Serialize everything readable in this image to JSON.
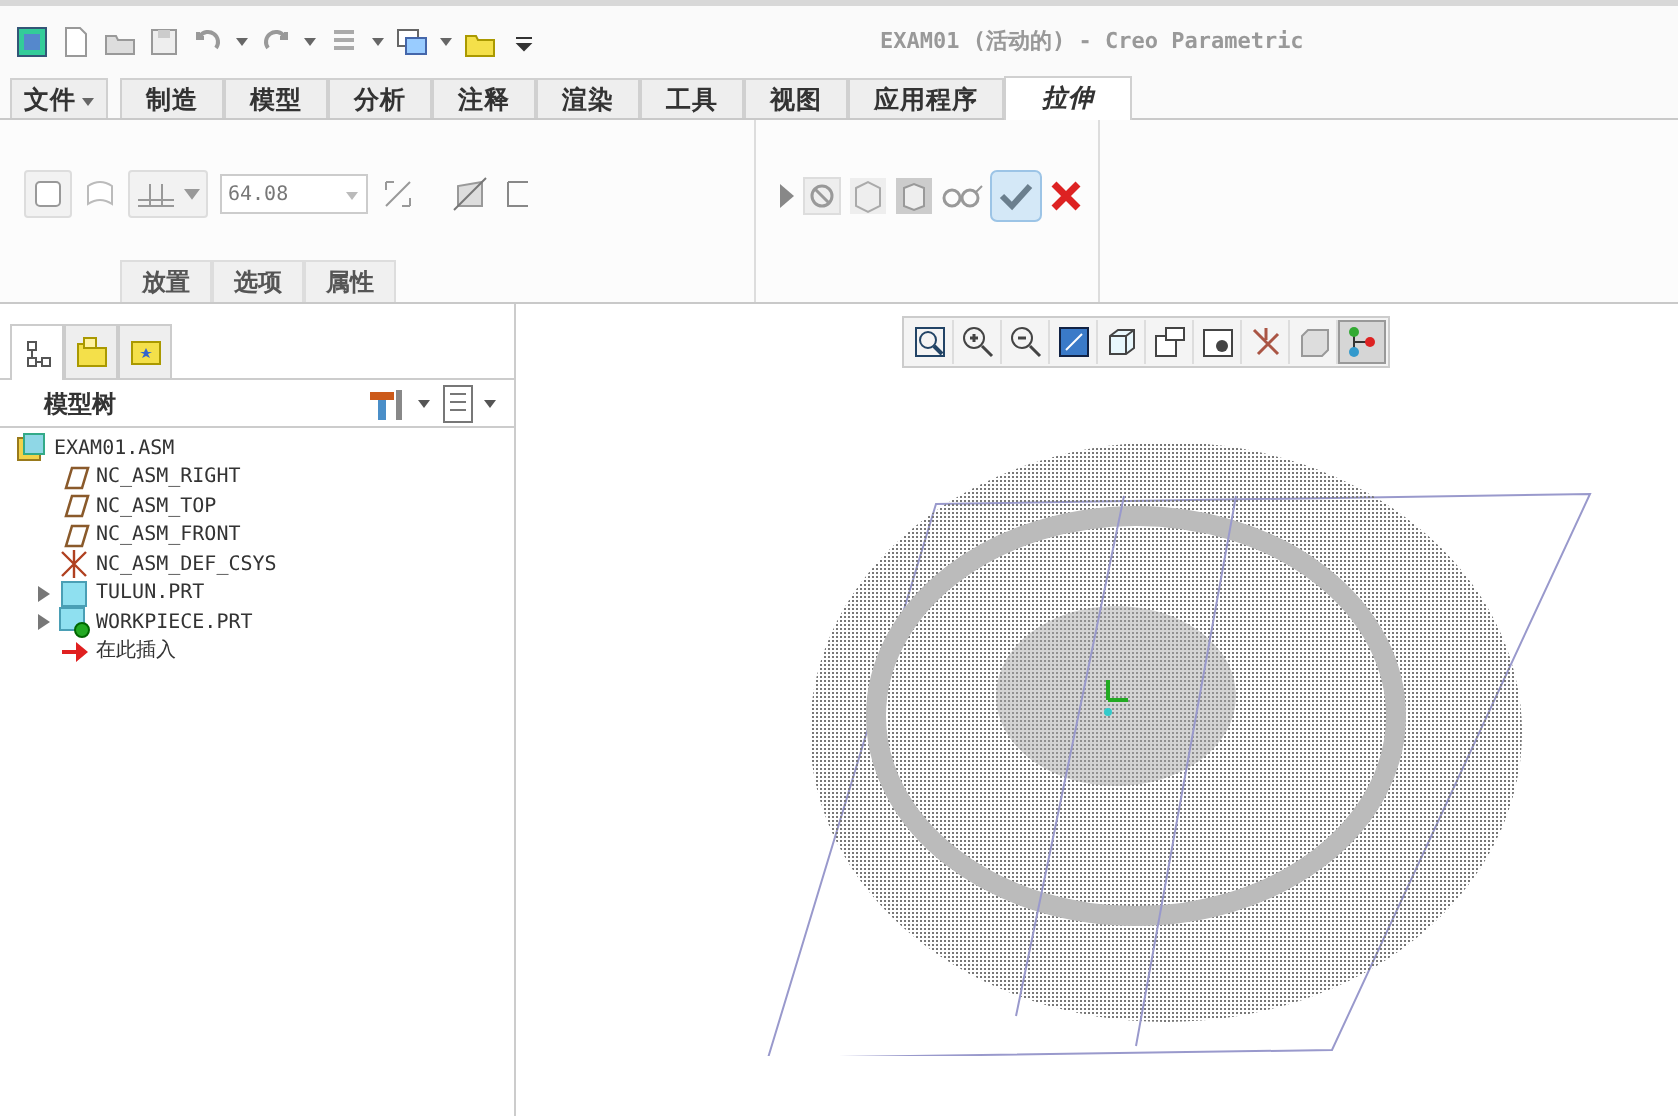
{
  "window": {
    "title": "EXAM01 (活动的) - Creo Parametric"
  },
  "ribbon_tabs": [
    {
      "label": "文件",
      "kind": "menu",
      "selected": false
    },
    {
      "label": "制造",
      "kind": "tab",
      "selected": false
    },
    {
      "label": "模型",
      "kind": "tab",
      "selected": false
    },
    {
      "label": "分析",
      "kind": "tab",
      "selected": false
    },
    {
      "label": "注释",
      "kind": "tab",
      "selected": false
    },
    {
      "label": "渲染",
      "kind": "tab",
      "selected": false
    },
    {
      "label": "工具",
      "kind": "tab",
      "selected": false
    },
    {
      "label": "视图",
      "kind": "tab",
      "selected": false
    },
    {
      "label": "应用程序",
      "kind": "tab",
      "selected": false
    },
    {
      "label": "拉伸",
      "kind": "tab",
      "selected": true
    }
  ],
  "dashboard": {
    "depth_value": "64.08",
    "sub_tabs": [
      "放置",
      "选项",
      "属性"
    ]
  },
  "panel_tabs": [
    {
      "kind": "tree",
      "selected": true
    },
    {
      "kind": "folder",
      "selected": false
    },
    {
      "kind": "favorites",
      "selected": false
    }
  ],
  "model_tree": {
    "title": "模型树",
    "items": [
      {
        "label": "EXAM01.ASM",
        "kind": "assembly",
        "children": [
          {
            "label": "NC_ASM_RIGHT",
            "kind": "plane"
          },
          {
            "label": "NC_ASM_TOP",
            "kind": "plane"
          },
          {
            "label": "NC_ASM_FRONT",
            "kind": "plane"
          },
          {
            "label": "NC_ASM_DEF_CSYS",
            "kind": "csys"
          },
          {
            "label": "TULUN.PRT",
            "kind": "part",
            "expanded": false
          },
          {
            "label": "WORKPIECE.PRT",
            "kind": "workpiece",
            "expanded": false
          },
          {
            "label": "在此插入",
            "kind": "insert"
          }
        ]
      }
    ]
  },
  "view_toolbar": [
    {
      "kind": "zoom-fit",
      "selected": false
    },
    {
      "kind": "zoom-in",
      "selected": false
    },
    {
      "kind": "zoom-out",
      "selected": false
    },
    {
      "kind": "repaint",
      "selected": false
    },
    {
      "kind": "cube",
      "selected": false
    },
    {
      "kind": "views",
      "selected": false
    },
    {
      "kind": "camera",
      "selected": false
    },
    {
      "kind": "datum",
      "selected": false
    },
    {
      "kind": "shade",
      "selected": false
    },
    {
      "kind": "spin",
      "selected": true
    }
  ]
}
